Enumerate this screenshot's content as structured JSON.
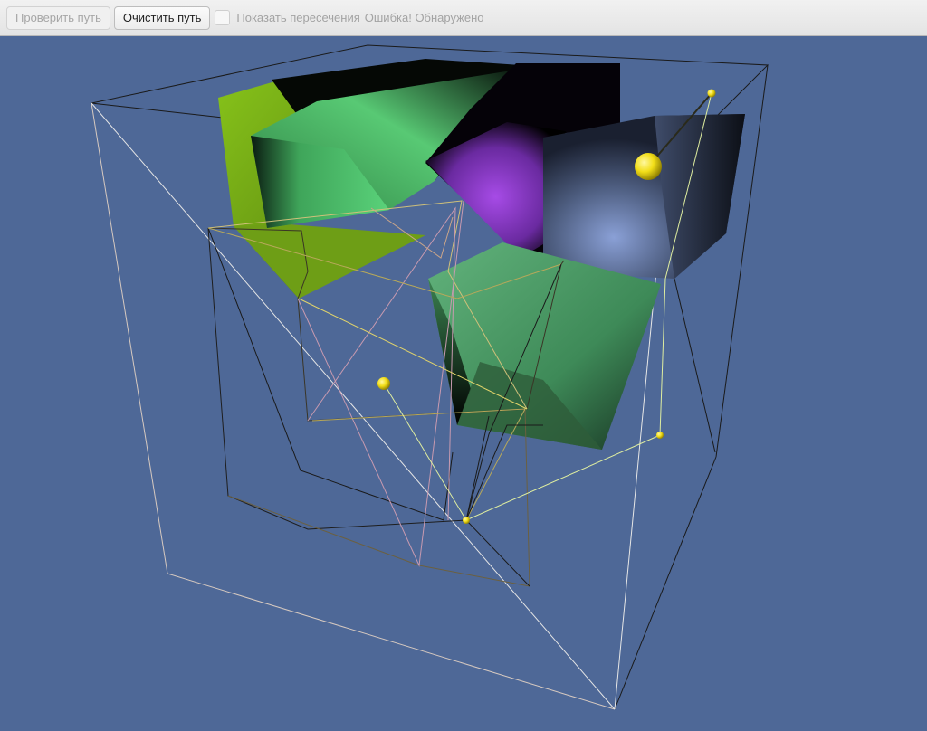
{
  "toolbar": {
    "check_path_label": "Проверить путь",
    "clear_path_label": "Очистить путь",
    "show_intersections_label": "Показать пересечения",
    "status_text": "Ошибка! Обнаружено"
  },
  "viewport": {
    "background": "#4e6897",
    "objects": [
      {
        "name": "lime-box",
        "color": "#86b81c"
      },
      {
        "name": "green-box",
        "color": "#55c26e"
      },
      {
        "name": "purple-box",
        "color": "#9a47d9"
      },
      {
        "name": "slate-box",
        "color": "#5e6f95"
      },
      {
        "name": "dark-green-box",
        "color": "#4f9a68"
      }
    ],
    "path_colors": {
      "path": "#dfeea0",
      "node": "#f4e21c"
    }
  }
}
